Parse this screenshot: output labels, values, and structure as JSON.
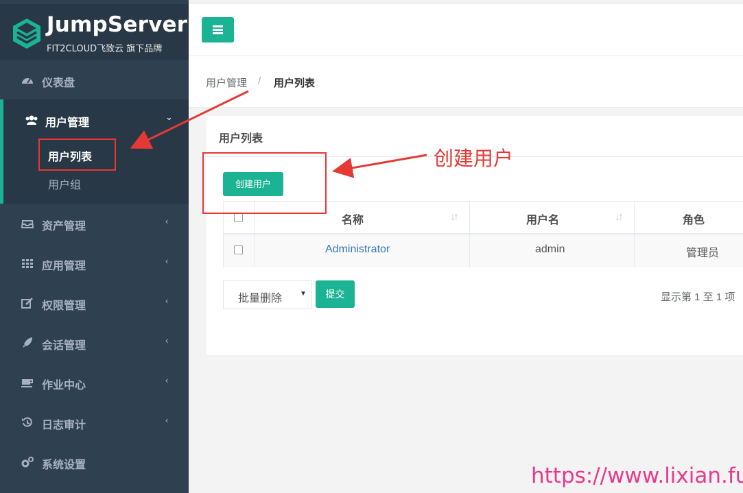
{
  "brand": {
    "title": "JumpServer",
    "subtitle": "FIT2CLOUD飞致云 旗下品牌"
  },
  "sidebar": {
    "items": [
      {
        "label": "仪表盘",
        "icon": "dashboard-icon"
      },
      {
        "label": "用户管理",
        "icon": "users-icon",
        "expanded": true,
        "children": [
          {
            "label": "用户列表",
            "active": true
          },
          {
            "label": "用户组"
          }
        ]
      },
      {
        "label": "资产管理",
        "icon": "inbox-icon"
      },
      {
        "label": "应用管理",
        "icon": "grid-icon"
      },
      {
        "label": "权限管理",
        "icon": "edit-icon"
      },
      {
        "label": "会话管理",
        "icon": "rocket-icon"
      },
      {
        "label": "作业中心",
        "icon": "coffee-icon"
      },
      {
        "label": "日志审计",
        "icon": "history-icon"
      },
      {
        "label": "系统设置",
        "icon": "gears-icon"
      }
    ]
  },
  "breadcrumb": {
    "parent": "用户管理",
    "separator": "/",
    "current": "用户列表"
  },
  "panel": {
    "title": "用户列表",
    "create_button": "创建用户"
  },
  "table": {
    "columns": [
      "名称",
      "用户名",
      "角色"
    ],
    "rows": [
      {
        "name": "Administrator",
        "username": "admin",
        "role": "管理员"
      }
    ]
  },
  "bulk": {
    "selected": "批量删除",
    "submit": "提交"
  },
  "pagination": {
    "info": "显示第 1 至 1 项"
  },
  "annotation": {
    "label": "创建用户",
    "watermark": "https://www.lixian.fun"
  },
  "colors": {
    "accent": "#1ab394",
    "sidebar": "#2f4050",
    "annotation": "#e53935",
    "watermark": "#e8398a"
  }
}
